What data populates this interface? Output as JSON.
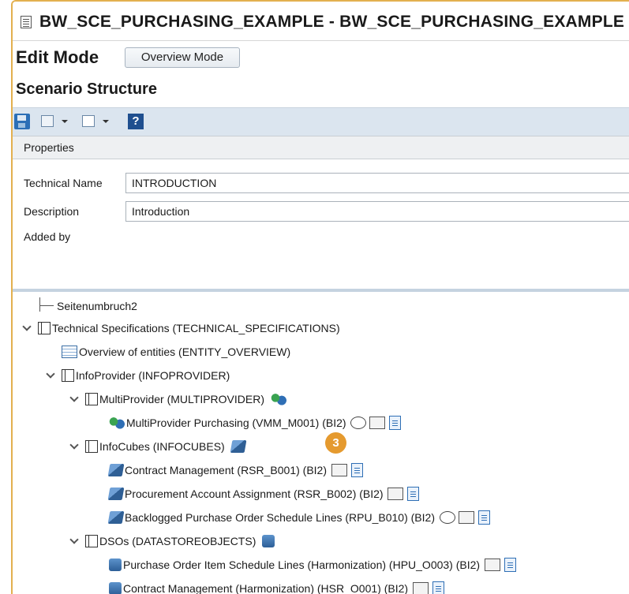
{
  "window": {
    "title": "BW_SCE_PURCHASING_EXAMPLE - BW_SCE_PURCHASING_EXAMPLE"
  },
  "mode": {
    "label": "Edit Mode",
    "overview_button": "Overview Mode"
  },
  "section": {
    "title": "Scenario Structure"
  },
  "toolbar": {
    "help_label": "?"
  },
  "properties": {
    "header": "Properties",
    "technical_name_label": "Technical Name",
    "technical_name_value": "INTRODUCTION",
    "description_label": "Description",
    "description_value": "Introduction",
    "added_by_label": "Added by"
  },
  "tree": {
    "page_break": "Seitenumbruch2",
    "technical_specs": "Technical Specifications (TECHNICAL_SPECIFICATIONS)",
    "overview_entities": "Overview of entities (ENTITY_OVERVIEW)",
    "infoprovider": "InfoProvider (INFOPROVIDER)",
    "multiprovider": "MultiProvider (MULTIPROVIDER)",
    "multiprovider_purchasing": "MultiProvider Purchasing (VMM_M001) (BI2)",
    "infocubes": "InfoCubes (INFOCUBES)",
    "contract_management": "Contract Management (RSR_B001) (BI2)",
    "procurement_account": "Procurement Account Assignment (RSR_B002) (BI2)",
    "backlogged": "Backlogged Purchase Order Schedule Lines (RPU_B010) (BI2)",
    "dsos": "DSOs (DATASTOREOBJECTS)",
    "po_item_schedule": "Purchase Order Item Schedule Lines (Harmonization) (HPU_O003) (BI2)",
    "contract_mgmt_harm": "Contract Management (Harmonization) (HSR_O001) (BI2)"
  },
  "callout": {
    "number": "3"
  }
}
